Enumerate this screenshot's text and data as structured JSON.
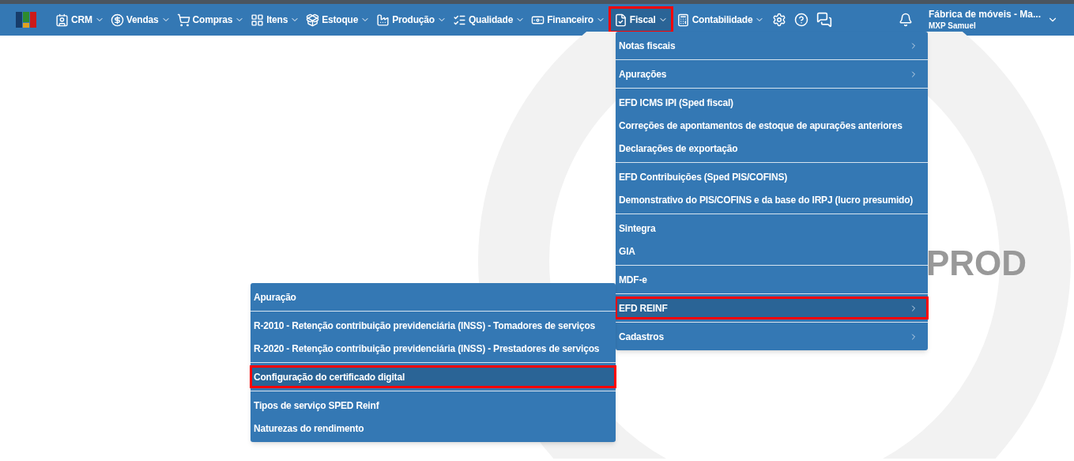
{
  "navbar": {
    "items": [
      {
        "label": "CRM",
        "kind": "crm",
        "selected": false
      },
      {
        "label": "Vendas",
        "kind": "sales",
        "selected": false
      },
      {
        "label": "Compras",
        "kind": "purchases",
        "selected": false
      },
      {
        "label": "Itens",
        "kind": "items",
        "selected": false
      },
      {
        "label": "Estoque",
        "kind": "stock",
        "selected": false
      },
      {
        "label": "Produção",
        "kind": "production",
        "selected": false
      },
      {
        "label": "Qualidade",
        "kind": "quality",
        "selected": false
      },
      {
        "label": "Financeiro",
        "kind": "finance",
        "selected": false
      },
      {
        "label": "Fiscal",
        "kind": "fiscal",
        "selected": true
      },
      {
        "label": "Contabilidade",
        "kind": "accounting",
        "selected": false
      }
    ],
    "company": "Fábrica de móveis - Ma...",
    "user": "MXP Samuel"
  },
  "background_label": "PROD",
  "fiscal_menu": [
    [
      {
        "label": "Notas fiscais",
        "submenu": true,
        "selected": false
      }
    ],
    [
      {
        "label": "Apurações",
        "submenu": true,
        "selected": false
      }
    ],
    [
      {
        "label": "EFD ICMS IPI (Sped fiscal)",
        "submenu": false,
        "selected": false
      },
      {
        "label": "Correções de apontamentos de estoque de apurações anteriores",
        "submenu": false,
        "selected": false
      },
      {
        "label": "Declarações de exportação",
        "submenu": false,
        "selected": false
      }
    ],
    [
      {
        "label": "EFD Contribuições (Sped PIS/COFINS)",
        "submenu": false,
        "selected": false
      },
      {
        "label": "Demonstrativo do PIS/COFINS e da base do IRPJ (lucro presumido)",
        "submenu": false,
        "selected": false
      }
    ],
    [
      {
        "label": "Sintegra",
        "submenu": false,
        "selected": false
      },
      {
        "label": "GIA",
        "submenu": false,
        "selected": false
      }
    ],
    [
      {
        "label": "MDF-e",
        "submenu": false,
        "selected": false
      }
    ],
    [
      {
        "label": "EFD REINF",
        "submenu": true,
        "selected": true
      }
    ],
    [
      {
        "label": "Cadastros",
        "submenu": true,
        "selected": false
      }
    ]
  ],
  "reinf_menu": [
    [
      {
        "label": "Apuração",
        "selected": false
      }
    ],
    [
      {
        "label": "R-2010 - Retenção contribuição previdenciária (INSS) - Tomadores de serviços",
        "selected": false
      },
      {
        "label": "R-2020 - Retenção contribuição previdenciária (INSS) - Prestadores de serviços",
        "selected": false
      }
    ],
    [
      {
        "label": "Configuração do certificado digital",
        "selected": true
      }
    ],
    [
      {
        "label": "Tipos de serviço SPED Reinf",
        "selected": false
      },
      {
        "label": "Naturezas do rendimento",
        "selected": false
      }
    ]
  ]
}
